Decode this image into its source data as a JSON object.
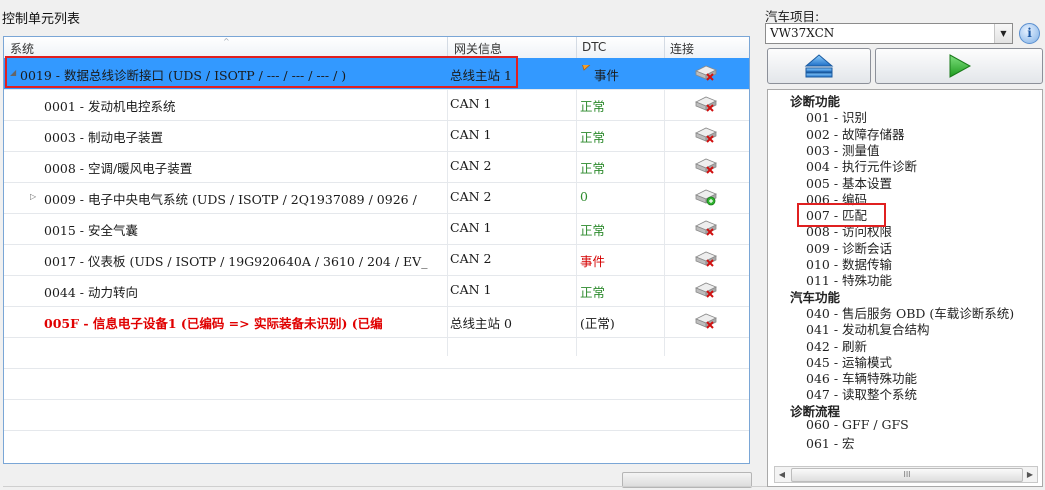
{
  "left_panel": {
    "title": "控制单元列表",
    "columns": [
      "系统",
      "网关信息",
      "DTC",
      "连接"
    ],
    "rows": [
      {
        "system": "0019 - 数据总线诊断接口  (UDS / ISOTP / --- / --- / --- / )",
        "gateway": "总线主站  1",
        "dtc": "事件",
        "dtc_status": "event",
        "selected": true,
        "expander": "◢"
      },
      {
        "system": "0001 - 发动机电控系统",
        "gateway": "CAN 1",
        "dtc": "正常",
        "dtc_status": "ok"
      },
      {
        "system": "0003 - 制动电子装置",
        "gateway": "CAN 1",
        "dtc": "正常",
        "dtc_status": "ok"
      },
      {
        "system": "0008 - 空调/暖风电子装置",
        "gateway": "CAN 2",
        "dtc": "正常",
        "dtc_status": "ok"
      },
      {
        "system": "0009 - 电子中央电气系统  (UDS / ISOTP / 2Q1937089 / 0926 / ",
        "gateway": "CAN 2",
        "dtc": "0",
        "dtc_status": "ok",
        "expander": "▷"
      },
      {
        "system": "0015 - 安全气囊",
        "gateway": "CAN 1",
        "dtc": "正常",
        "dtc_status": "ok"
      },
      {
        "system": "0017 - 仪表板  (UDS / ISOTP / 19G920640A / 3610 / 204 / EV_",
        "gateway": "CAN 2",
        "dtc": "事件",
        "dtc_status": "error"
      },
      {
        "system": "0044 - 动力转向",
        "gateway": "CAN 1",
        "dtc": "正常",
        "dtc_status": "ok"
      },
      {
        "system": "005F - 信息电子设备1  (已编码 => 实际装备未识别)  (已编",
        "gateway": "总线主站 0",
        "dtc": "(正常)",
        "dtc_status": "plain",
        "red_bold": true
      }
    ]
  },
  "right_panel": {
    "vehicle_label": "汽车项目:",
    "vehicle_value": "VW37XCN",
    "info_icon": "i",
    "tree": [
      {
        "type": "group",
        "label": "诊断功能"
      },
      {
        "type": "item",
        "label": "001 - 识别"
      },
      {
        "type": "item",
        "label": "002 - 故障存储器"
      },
      {
        "type": "item",
        "label": "003 - 测量值"
      },
      {
        "type": "item",
        "label": "004 - 执行元件诊断"
      },
      {
        "type": "item",
        "label": "005 - 基本设置"
      },
      {
        "type": "item",
        "label": "006 - 编码"
      },
      {
        "type": "item",
        "label": "007 - 匹配",
        "highlight": true
      },
      {
        "type": "item",
        "label": "008 - 访问权限"
      },
      {
        "type": "item",
        "label": "009 - 诊断会话"
      },
      {
        "type": "item",
        "label": "010 - 数据传输"
      },
      {
        "type": "item",
        "label": "011 - 特殊功能"
      },
      {
        "type": "group",
        "label": "汽车功能"
      },
      {
        "type": "item",
        "label": "040 - 售后服务 OBD (车载诊断系统)"
      },
      {
        "type": "item",
        "label": "041 - 发动机复合结构"
      },
      {
        "type": "item",
        "label": "042 - 刷新"
      },
      {
        "type": "item",
        "label": "045 - 运输模式"
      },
      {
        "type": "item",
        "label": "046 - 车辆特殊功能"
      },
      {
        "type": "item",
        "label": "047 - 读取整个系统"
      },
      {
        "type": "group",
        "label": "诊断流程"
      },
      {
        "type": "item",
        "label": "060 - GFF / GFS"
      },
      {
        "type": "item",
        "label": "061 - 宏"
      }
    ],
    "scroll_thumb": "III"
  },
  "colors": {
    "ok": "#2e8b2e",
    "error": "#d40000",
    "selection": "#3399ff",
    "highlight_box": "#e02020"
  }
}
